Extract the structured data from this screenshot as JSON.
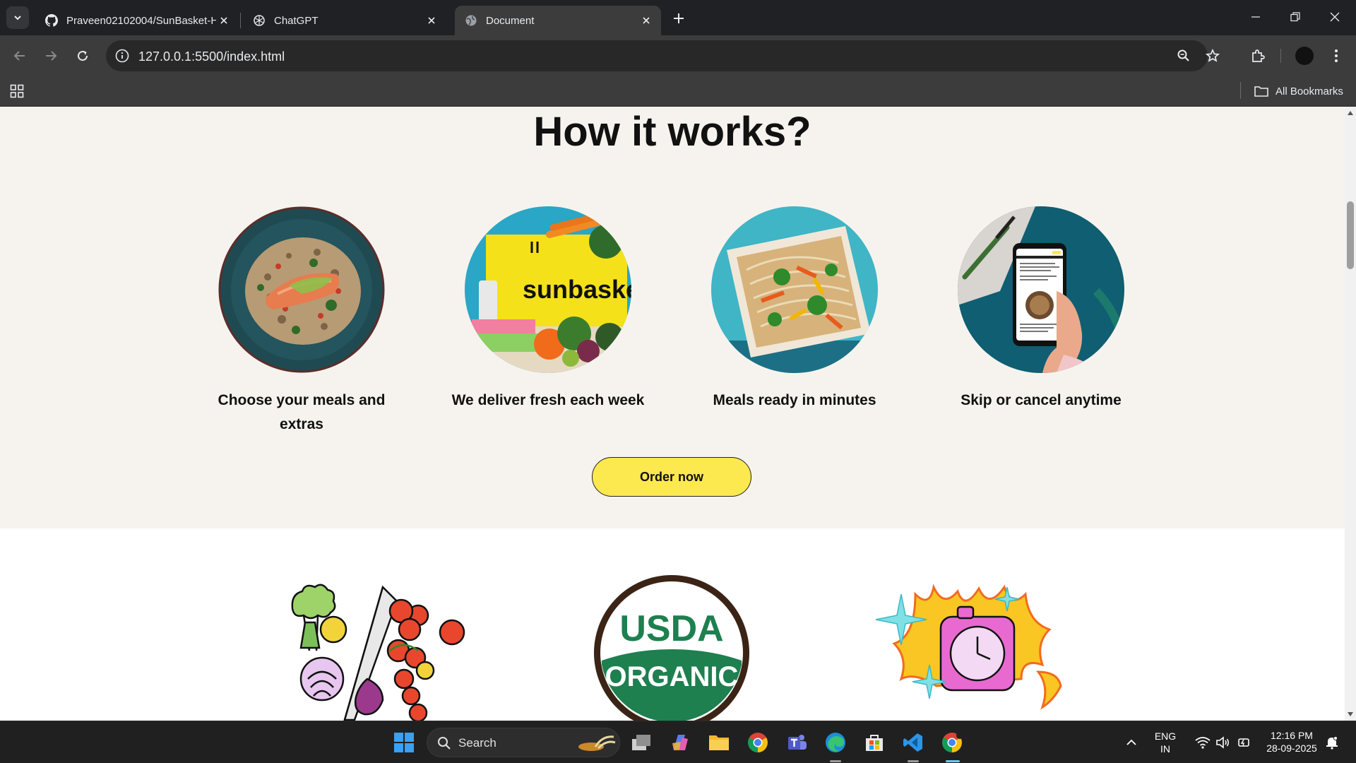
{
  "browser": {
    "tabs": [
      {
        "title": "Praveen02102004/SunBasket-H",
        "icon": "github-icon",
        "active": false
      },
      {
        "title": "ChatGPT",
        "icon": "chatgpt-icon",
        "active": false
      },
      {
        "title": "Document",
        "icon": "globe-icon",
        "active": true
      }
    ],
    "url": "127.0.0.1:5500/index.html",
    "bookmarks_label": "All Bookmarks"
  },
  "page": {
    "heading": "How it works?",
    "steps": [
      {
        "caption": "Choose your meals and extras",
        "image": "salmon-grain-bowl"
      },
      {
        "caption": "We deliver fresh each week",
        "image": "sunbasket-delivery-box"
      },
      {
        "caption": "Meals ready in minutes",
        "image": "noodle-stir-fry-tray"
      },
      {
        "caption": "Skip or cancel anytime",
        "image": "phone-app-in-hand"
      }
    ],
    "cta_label": "Order now",
    "features": [
      {
        "image": "vegetables-illustration"
      },
      {
        "image": "usda-organic-seal",
        "seal_top": "USDA",
        "seal_bottom": "ORGANIC"
      },
      {
        "image": "timer-on-fire-illustration"
      }
    ]
  },
  "taskbar": {
    "search_label": "Search",
    "lang_top": "ENG",
    "lang_bottom": "IN",
    "time": "12:16 PM",
    "date": "28-09-2025"
  },
  "colors": {
    "section_bg": "#f6f3ee",
    "cta_yellow": "#fce94f",
    "usda_green": "#1e7f4f",
    "usda_brown": "#3b2416"
  }
}
